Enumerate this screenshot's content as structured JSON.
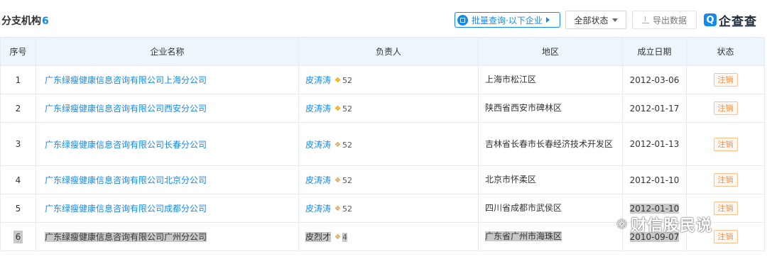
{
  "header": {
    "title": "分支机构",
    "count": "6",
    "batch_query_label": "批量查询·以下企业",
    "status_filter_label": "全部状态",
    "export_label": "导出数据",
    "brand_mark": "Q",
    "brand_name": "企查查"
  },
  "table": {
    "columns": [
      "序号",
      "企业名称",
      "负责人",
      "地区",
      "成立日期",
      "状态"
    ],
    "rows": [
      {
        "seq": "1",
        "name": "广东绿瘦健康信息咨询有限公司上海分公司",
        "person": "皮涛涛",
        "person_count": "52",
        "region": "上海市松江区",
        "date": "2012-03-06",
        "status": "注销"
      },
      {
        "seq": "2",
        "name": "广东绿瘦健康信息咨询有限公司西安分公司",
        "person": "皮涛涛",
        "person_count": "52",
        "region": "陕西省西安市碑林区",
        "date": "2012-01-17",
        "status": "注销"
      },
      {
        "seq": "3",
        "name": "广东绿瘦健康信息咨询有限公司长春分公司",
        "person": "皮涛涛",
        "person_count": "52",
        "region": "吉林省长春市长春经济技术开发区",
        "date": "2012-01-13",
        "status": "注销"
      },
      {
        "seq": "4",
        "name": "广东绿瘦健康信息咨询有限公司北京分公司",
        "person": "皮涛涛",
        "person_count": "52",
        "region": "北京市怀柔区",
        "date": "2012-01-10",
        "status": "注销"
      },
      {
        "seq": "5",
        "name": "广东绿瘦健康信息咨询有限公司成都分公司",
        "person": "皮涛涛",
        "person_count": "52",
        "region": "四川省成都市武侯区",
        "date": "2012-01-10",
        "status": "注销"
      },
      {
        "seq": "6",
        "name": "广东绿瘦健康信息咨询有限公司广州分公司",
        "person": "皮烈才",
        "person_count": "4",
        "region": "广东省广州市海珠区",
        "date": "2010-09-07",
        "status": "注销"
      }
    ]
  },
  "watermark": {
    "text": "财信股民说",
    "icon": "wechat-icon"
  },
  "colors": {
    "accent": "#128bed",
    "status_orange": "#ff8b3d",
    "header_bg": "#eef6fd"
  }
}
